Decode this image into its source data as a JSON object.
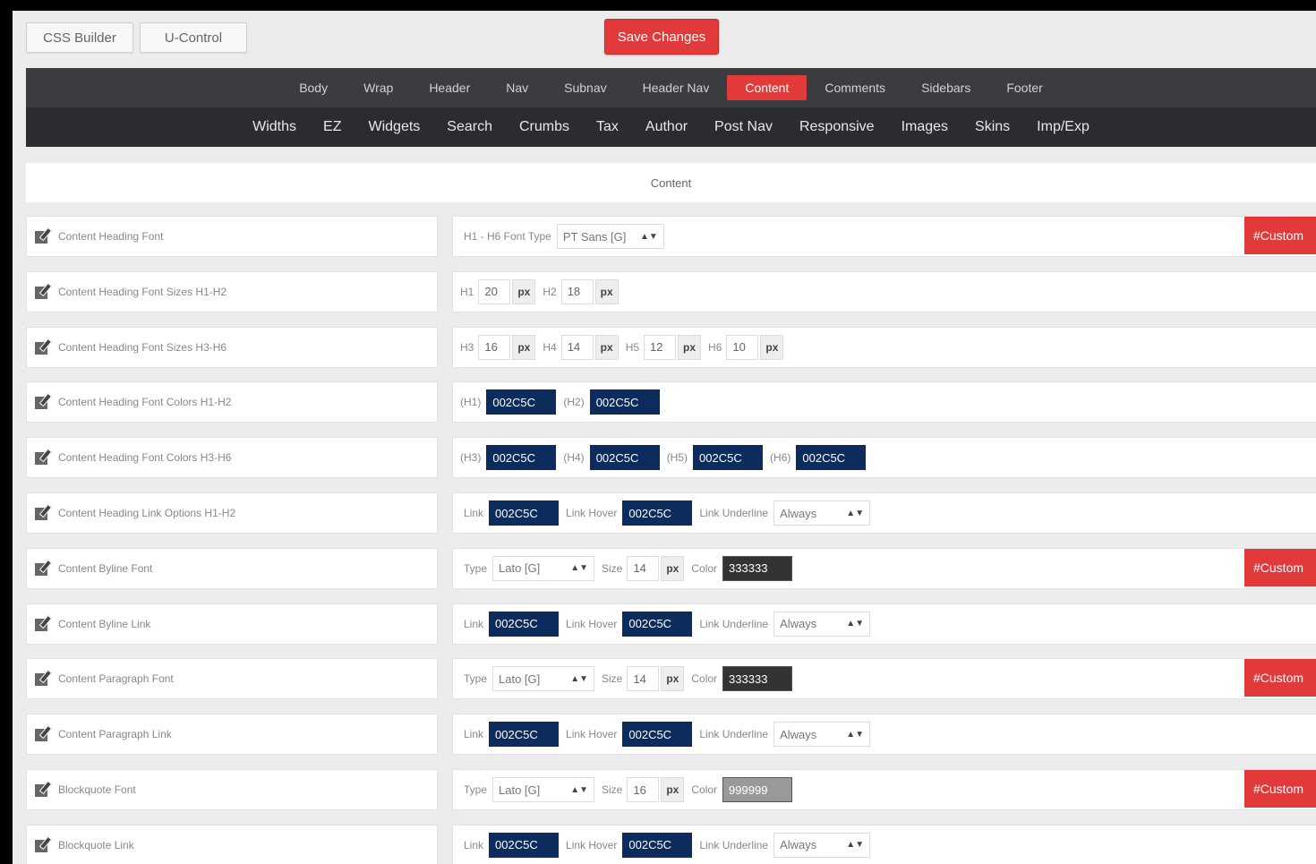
{
  "toolbar": {
    "css_builder": "CSS Builder",
    "ucontrol": "U-Control",
    "save": "Save Changes"
  },
  "nav": {
    "row1": [
      "Body",
      "Wrap",
      "Header",
      "Nav",
      "Subnav",
      "Header Nav",
      "Content",
      "Comments",
      "Sidebars",
      "Footer"
    ],
    "row2": [
      "Widths",
      "EZ",
      "Widgets",
      "Search",
      "Crumbs",
      "Tax",
      "Author",
      "Post Nav",
      "Responsive",
      "Images",
      "Skins",
      "Imp/Exp"
    ],
    "active": "Content"
  },
  "section_title": "Content",
  "custom_label": "#Custom",
  "rows": [
    {
      "label": "Content Heading Font",
      "h_font_label": "H1 - H6 Font Type",
      "font_value": "PT Sans [G]",
      "custom": true
    },
    {
      "label": "Content Heading Font Sizes H1-H2",
      "sizes": [
        {
          "label": "H1",
          "value": "20",
          "unit": "px"
        },
        {
          "label": "H2",
          "value": "18",
          "unit": "px"
        }
      ]
    },
    {
      "label": "Content Heading Font Sizes H3-H6",
      "sizes": [
        {
          "label": "H3",
          "value": "16",
          "unit": "px"
        },
        {
          "label": "H4",
          "value": "14",
          "unit": "px"
        },
        {
          "label": "H5",
          "value": "12",
          "unit": "px"
        },
        {
          "label": "H6",
          "value": "10",
          "unit": "px"
        }
      ]
    },
    {
      "label": "Content Heading Font Colors H1-H2",
      "colors": [
        {
          "label": "(H1)",
          "value": "002C5C"
        },
        {
          "label": "(H2)",
          "value": "002C5C"
        }
      ]
    },
    {
      "label": "Content Heading Font Colors H3-H6",
      "colors": [
        {
          "label": "(H3)",
          "value": "002C5C"
        },
        {
          "label": "(H4)",
          "value": "002C5C"
        },
        {
          "label": "(H5)",
          "value": "002C5C"
        },
        {
          "label": "(H6)",
          "value": "002C5C"
        }
      ]
    },
    {
      "label": "Content Heading Link Options H1-H2",
      "link": "002C5C",
      "hover": "002C5C",
      "underline": "Always"
    },
    {
      "label": "Content Byline Font",
      "type": "Lato [G]",
      "size": "14",
      "unit": "px",
      "color": "333333",
      "color_hex": "#333333",
      "custom": true
    },
    {
      "label": "Content Byline Link",
      "link": "002C5C",
      "hover": "002C5C",
      "underline": "Always"
    },
    {
      "label": "Content Paragraph Font",
      "type": "Lato [G]",
      "size": "14",
      "unit": "px",
      "color": "333333",
      "color_hex": "#333333",
      "custom": true
    },
    {
      "label": "Content Paragraph Link",
      "link": "002C5C",
      "hover": "002C5C",
      "underline": "Always"
    },
    {
      "label": "Blockquote Font",
      "type": "Lato [G]",
      "size": "16",
      "unit": "px",
      "color": "999999",
      "color_hex": "#999999",
      "custom": true
    },
    {
      "label": "Blockquote Link",
      "link": "002C5C",
      "hover": "002C5C",
      "underline": "Always"
    }
  ],
  "field_labels": {
    "link": "Link",
    "hover": "Link Hover",
    "underline": "Link Underline",
    "type": "Type",
    "size": "Size",
    "color": "Color"
  },
  "colors": {
    "accent": "#e23a3a",
    "navy": "#0d2c5e",
    "nav_bg": "#2a2c30"
  }
}
